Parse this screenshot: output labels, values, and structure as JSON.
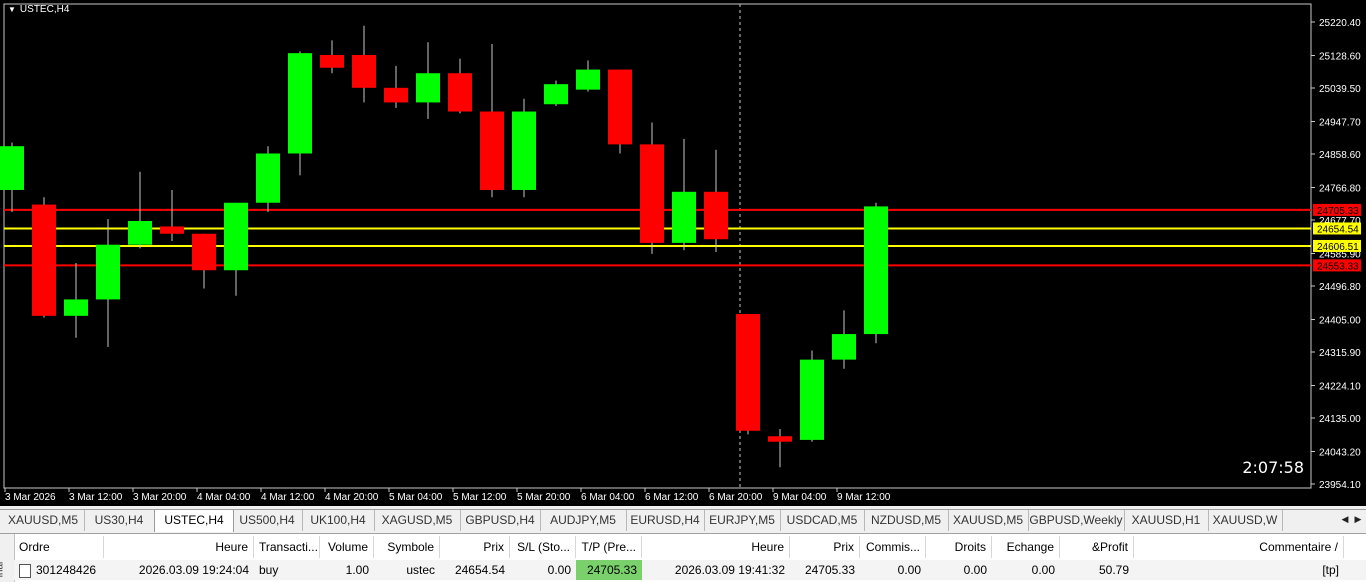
{
  "window": {
    "symbol_label": "USTEC,H4"
  },
  "chart_data": {
    "type": "candlestick",
    "symbol": "USTEC",
    "timeframe": "H4",
    "ylim": [
      23954.1,
      25260
    ],
    "y_ticks": [
      25220.4,
      25128.6,
      25039.5,
      24947.7,
      24858.6,
      24766.8,
      24677.7,
      24585.9,
      24496.8,
      24405.0,
      24315.9,
      24224.1,
      24135.0,
      24043.2,
      23954.1
    ],
    "y_tick_labels": [
      "25220.40",
      "25128.60",
      "25039.50",
      "24947.70",
      "24858.60",
      "24766.80",
      "24677.70",
      "24585.90",
      "24496.80",
      "24405.00",
      "24315.90",
      "24224.10",
      "24135.00",
      "24043.20",
      "23954.10"
    ],
    "x_labels": [
      "3 Mar 2026",
      "3 Mar 12:00",
      "3 Mar 20:00",
      "4 Mar 04:00",
      "4 Mar 12:00",
      "4 Mar 20:00",
      "5 Mar 04:00",
      "5 Mar 12:00",
      "5 Mar 20:00",
      "6 Mar 04:00",
      "6 Mar 12:00",
      "6 Mar 20:00",
      "9 Mar 04:00",
      "9 Mar 12:00"
    ],
    "candles": [
      {
        "o": 24760,
        "h": 24890,
        "l": 24700,
        "c": 24880
      },
      {
        "o": 24720,
        "h": 24740,
        "l": 24410,
        "c": 24415
      },
      {
        "o": 24415,
        "h": 24560,
        "l": 24355,
        "c": 24460
      },
      {
        "o": 24460,
        "h": 24680,
        "l": 24330,
        "c": 24610
      },
      {
        "o": 24610,
        "h": 24810,
        "l": 24600,
        "c": 24675
      },
      {
        "o": 24660,
        "h": 24760,
        "l": 24620,
        "c": 24640
      },
      {
        "o": 24640,
        "h": 24640,
        "l": 24490,
        "c": 24540
      },
      {
        "o": 24540,
        "h": 24720,
        "l": 24470,
        "c": 24725
      },
      {
        "o": 24725,
        "h": 24880,
        "l": 24700,
        "c": 24860
      },
      {
        "o": 24860,
        "h": 25140,
        "l": 24800,
        "c": 25135
      },
      {
        "o": 25130,
        "h": 25170,
        "l": 25080,
        "c": 25095
      },
      {
        "o": 25130,
        "h": 25210,
        "l": 25000,
        "c": 25040
      },
      {
        "o": 25040,
        "h": 25100,
        "l": 24985,
        "c": 25000
      },
      {
        "o": 25000,
        "h": 25165,
        "l": 24955,
        "c": 25080
      },
      {
        "o": 25080,
        "h": 25120,
        "l": 24970,
        "c": 24975
      },
      {
        "o": 24975,
        "h": 25160,
        "l": 24740,
        "c": 24760
      },
      {
        "o": 24760,
        "h": 25010,
        "l": 24740,
        "c": 24975
      },
      {
        "o": 24995,
        "h": 25060,
        "l": 24990,
        "c": 25050
      },
      {
        "o": 25035,
        "h": 25115,
        "l": 25030,
        "c": 25090
      },
      {
        "o": 25090,
        "h": 25090,
        "l": 24860,
        "c": 24885
      },
      {
        "o": 24885,
        "h": 24945,
        "l": 24585,
        "c": 24615
      },
      {
        "o": 24615,
        "h": 24900,
        "l": 24595,
        "c": 24755
      },
      {
        "o": 24755,
        "h": 24870,
        "l": 24590,
        "c": 24625
      },
      {
        "o": 24420,
        "h": 24420,
        "l": 24090,
        "c": 24100
      },
      {
        "o": 24085,
        "h": 24105,
        "l": 24000,
        "c": 24070
      },
      {
        "o": 24075,
        "h": 24320,
        "l": 24070,
        "c": 24295
      },
      {
        "o": 24295,
        "h": 24430,
        "l": 24270,
        "c": 24365
      },
      {
        "o": 24365,
        "h": 24725,
        "l": 24340,
        "c": 24715
      }
    ],
    "levels": [
      {
        "price": 24705.33,
        "label": "24705.33",
        "color": "#ff0000",
        "tag_bg": "#ff0000",
        "tag_fg": "#000000"
      },
      {
        "price": 24654.54,
        "label": "24654.54",
        "color": "#ffff00",
        "tag_bg": "#ffff00",
        "tag_fg": "#000000"
      },
      {
        "price": 24606.51,
        "label": "24606.51",
        "color": "#ffff00",
        "tag_bg": "#ffff00",
        "tag_fg": "#000000"
      },
      {
        "price": 24553.33,
        "label": "24553.33",
        "color": "#ff0000",
        "tag_bg": "#ff0000",
        "tag_fg": "#000000"
      }
    ],
    "up_color": "#00ff00",
    "down_color": "#ff0000",
    "background": "#000000",
    "crosshair_time": "6 Mar 20:00"
  },
  "countdown": "2:07:58",
  "tabs": [
    {
      "label": "XAUUSD,M5"
    },
    {
      "label": "US30,H4"
    },
    {
      "label": "USTEC,H4",
      "active": true
    },
    {
      "label": "US500,H4"
    },
    {
      "label": "UK100,H4"
    },
    {
      "label": "XAGUSD,M5"
    },
    {
      "label": "GBPUSD,H4"
    },
    {
      "label": "AUDJPY,M5"
    },
    {
      "label": "EURUSD,H4"
    },
    {
      "label": "EURJPY,M5"
    },
    {
      "label": "USDCAD,M5"
    },
    {
      "label": "NZDUSD,M5"
    },
    {
      "label": "XAUUSD,M5"
    },
    {
      "label": "GBPUSD,Weekly"
    },
    {
      "label": "XAUUSD,H1"
    },
    {
      "label": "XAUUSD,W"
    }
  ],
  "terminal": {
    "side_label": "inal",
    "close_glyph": "×",
    "headers": [
      "Ordre",
      "Heure",
      "Transacti...",
      "Volume",
      "Symbole",
      "Prix",
      "S/L (Sto...",
      "T/P (Pre...",
      "Heure",
      "Prix",
      "Commis...",
      "Droits",
      "Echange",
      "&Profit",
      "Commentaire  /"
    ],
    "rows": [
      [
        "301248426",
        "2026.03.09 19:24:04",
        "buy",
        "1.00",
        "ustec",
        "24654.54",
        "0.00",
        "24705.33",
        "2026.03.09 19:41:32",
        "24705.33",
        "0.00",
        "0.00",
        "0.00",
        "50.79",
        "[tp]"
      ]
    ]
  }
}
